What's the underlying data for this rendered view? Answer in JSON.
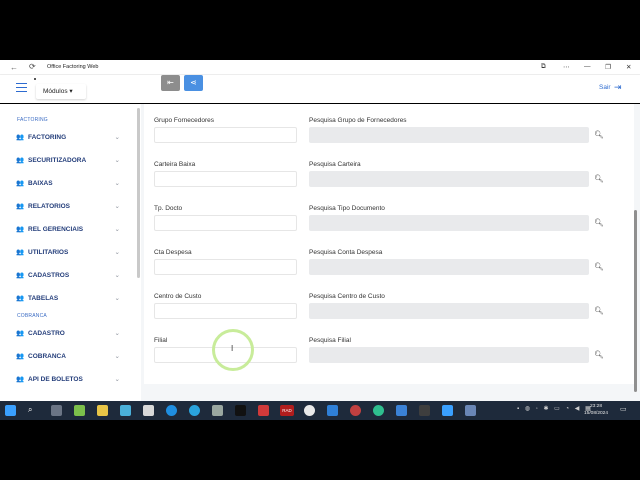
{
  "window": {
    "title": "Office Factoring Web"
  },
  "header": {
    "modulos_label": "Módulos ▾",
    "sair_label": "Sair"
  },
  "sidebar": {
    "sections": [
      {
        "label": "FACTORING"
      },
      {
        "label": "COBRANCA"
      }
    ],
    "factoring_items": [
      {
        "label": "FACTORING"
      },
      {
        "label": "SECURITIZADORA"
      },
      {
        "label": "BAIXAS"
      },
      {
        "label": "RELATORIOS"
      },
      {
        "label": "REL GERENCIAIS"
      },
      {
        "label": "UTILITARIOS"
      },
      {
        "label": "CADASTROS"
      },
      {
        "label": "TABELAS"
      }
    ],
    "cobranca_items": [
      {
        "label": "CADASTRO"
      },
      {
        "label": "COBRANCA"
      },
      {
        "label": "API DE BOLETOS"
      }
    ]
  },
  "form": {
    "rows": [
      {
        "label": "Grupo Fornecedores",
        "search_label": "Pesquisa Grupo de Fornecedores",
        "value": "",
        "search_value": ""
      },
      {
        "label": "Carteira Baixa",
        "search_label": "Pesquisa Carteira",
        "value": "",
        "search_value": ""
      },
      {
        "label": "Tp. Docto",
        "search_label": "Pesquisa Tipo Documento",
        "value": "",
        "search_value": ""
      },
      {
        "label": "Cta Despesa",
        "search_label": "Pesquisa Conta Despesa",
        "value": "",
        "search_value": ""
      },
      {
        "label": "Centro de Custo",
        "search_label": "Pesquisa Centro de Custo",
        "value": "",
        "search_value": ""
      },
      {
        "label": "Filial",
        "search_label": "Pesquisa Filial",
        "value": "",
        "search_value": ""
      }
    ]
  },
  "taskbar": {
    "time": "23:28",
    "date": "15/08/2024",
    "app_label": "RAD"
  },
  "colors": {
    "accent": "#2d6bd0",
    "sidebar_text": "#233d7a",
    "taskbar": "#1e2a3b"
  }
}
